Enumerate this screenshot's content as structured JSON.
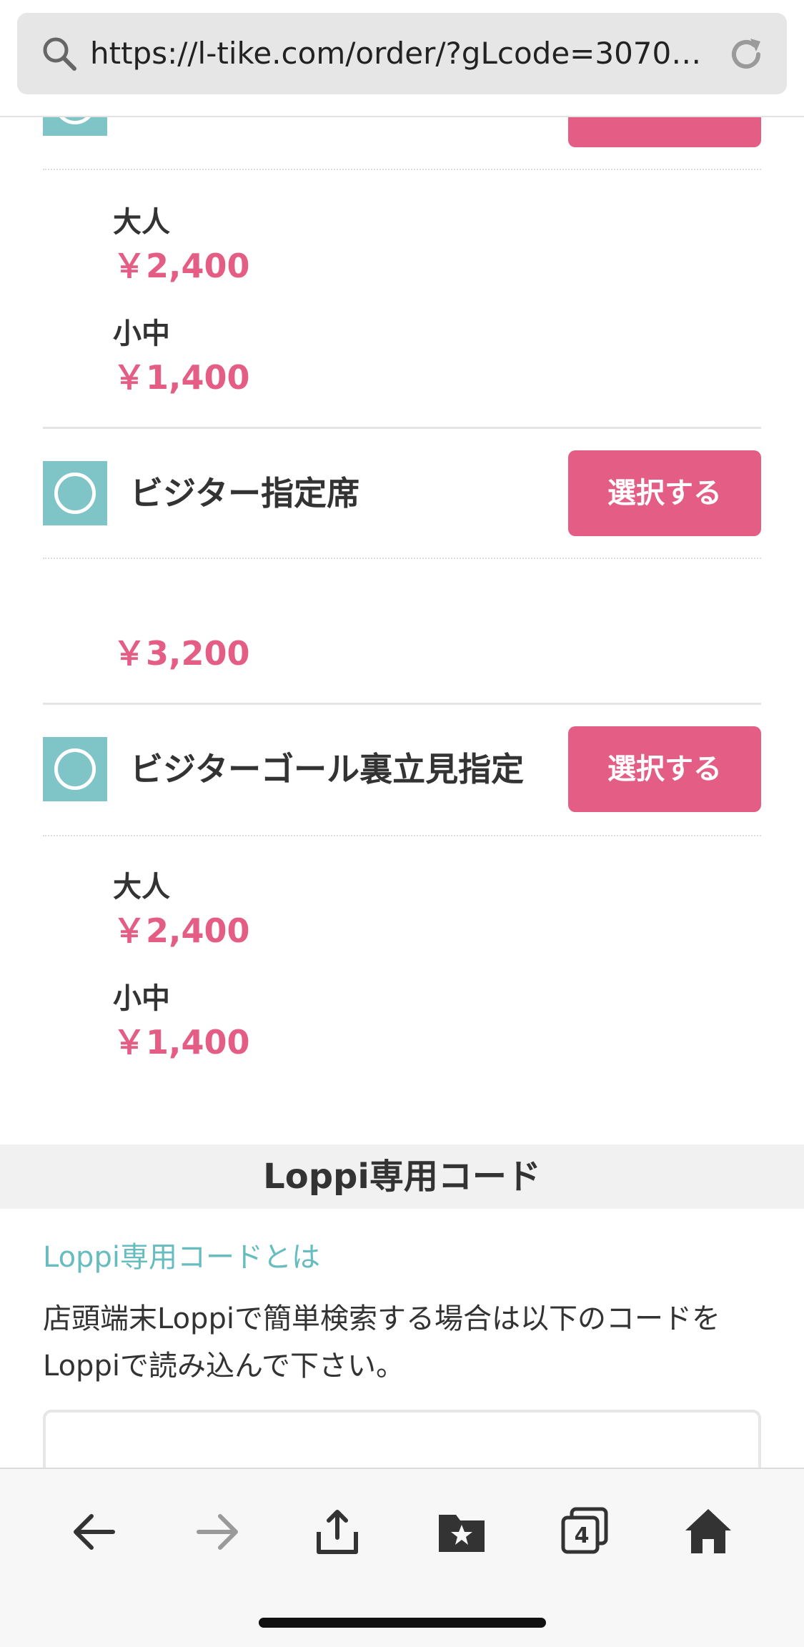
{
  "browser": {
    "url": "https://l-tike.com/order/?gLcode=30701…"
  },
  "seats": [
    {
      "name": "",
      "select_label": "",
      "prices": [
        {
          "label": "大人",
          "price": "￥2,400"
        },
        {
          "label": "小中",
          "price": "￥1,400"
        }
      ]
    },
    {
      "name": "ビジター指定席",
      "select_label": "選択する",
      "prices": [
        {
          "label": "",
          "price": "￥3,200"
        }
      ]
    },
    {
      "name": "ビジターゴール裏立見指定",
      "select_label": "選択する",
      "prices": [
        {
          "label": "大人",
          "price": "￥2,400"
        },
        {
          "label": "小中",
          "price": "￥1,400"
        }
      ]
    }
  ],
  "loppi": {
    "header": "Loppi専用コード",
    "link": "Loppi専用コードとは",
    "description": "店頭端末Loppiで簡単検索する場合は以下のコードをLoppiで読み込んで下さい。"
  },
  "toolbar": {
    "tab_count": "4"
  },
  "colors": {
    "accent_pink": "#e35d85",
    "radio_teal": "#7fc4c7",
    "link_teal": "#67bcbf"
  }
}
